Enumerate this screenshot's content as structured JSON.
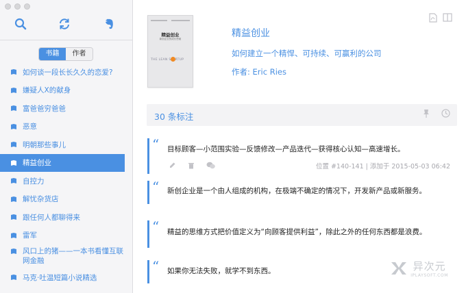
{
  "sidebar": {
    "segment": {
      "books_label": "书籍",
      "authors_label": "作者"
    },
    "books": [
      "如何谈一段长长久久的恋爱?",
      "嫌疑人X的献身",
      "富爸爸穷爸爸",
      "恶意",
      "明朝那些事儿",
      "精益创业",
      "自控力",
      "解忧杂货店",
      "跟任何人都聊得来",
      "雷军",
      "风口上的猪——一本书看懂互联网金融",
      "马克·吐温短篇小说精选"
    ]
  },
  "book": {
    "cover_title": "精益创业",
    "cover_subtitle": "新创企业的成长思维",
    "cover_english": "THE LEAN STARTUP",
    "title": "精益创业",
    "subtitle": "如何建立一个精悍、可持续、可赢利的公司",
    "author": "作者: Eric Ries"
  },
  "annotations": {
    "count_label": "30 条标注",
    "items": [
      {
        "text": "目标顾客—小范围实验—反馈修改—产品迭代—获得核心认知—高速增长。",
        "meta": "位置 #140-141 | 添加于 2015-05-03 06:42"
      },
      {
        "text": "新创企业是一个由人组成的机构，在极端不确定的情况下，开发新产品或新服务。"
      },
      {
        "text": "精益的思维方式把价值定义为“向顾客提供利益”，除此之外的任何东西都是浪费。"
      },
      {
        "text": "如果你无法失败，就学不到东西。"
      }
    ]
  },
  "watermark": {
    "cn": "异次元",
    "en": "IPLAYSOFT.COM"
  },
  "colors": {
    "accent": "#4a90e2",
    "sidebar_bg": "#f5f5f7"
  }
}
